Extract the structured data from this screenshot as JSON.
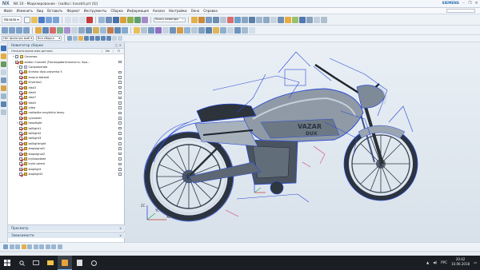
{
  "window": {
    "logo": "NX",
    "title": "NX 10 - Моделирование - [sadko i hovzd4.prt  (S)]",
    "brand": "SIEMENS",
    "controls": [
      "–",
      "❐",
      "✕"
    ]
  },
  "menu": {
    "items": [
      "Файл",
      "Изменить",
      "Вид",
      "Вставить",
      "Формат",
      "Инструменты",
      "Сборки",
      "Информация",
      "Анализ",
      "Настройки",
      "Окно",
      "Справка"
    ]
  },
  "toolbar": {
    "start_label": "Начало ▾",
    "command_search": "Поиск команды",
    "filter_label": "Нет фильтра выб",
    "scope_label": "Вся сборка"
  },
  "navigator": {
    "title": "Навигатор сборки",
    "column_name": "Описательное имя детали",
    "column_info": "Ин",
    "column_p": "П",
    "rows": [
      {
        "indent": 1,
        "expander": "+",
        "checked": false,
        "icon": "folder",
        "label": "Сечения",
        "box": false
      },
      {
        "indent": 1,
        "expander": "–",
        "checked": true,
        "icon": "asm",
        "label": "sadko i hovzd4 (Последовательность: Хра...",
        "box": true
      },
      {
        "indent": 2,
        "expander": "+",
        "checked": false,
        "icon": "con",
        "label": "Сопряжения",
        "box": false
      },
      {
        "indent": 2,
        "expander": "",
        "checked": true,
        "icon": "part",
        "label": "shirsha dlya proverka 5",
        "box": true
      },
      {
        "indent": 2,
        "expander": "",
        "checked": true,
        "icon": "part",
        "label": "korpus batarei",
        "box": true
      },
      {
        "indent": 2,
        "expander": "",
        "checked": true,
        "icon": "part",
        "label": "Kryshka1",
        "box": true
      },
      {
        "indent": 2,
        "expander": "",
        "checked": true,
        "icon": "part",
        "label": "disk3",
        "box": true
      },
      {
        "indent": 2,
        "expander": "",
        "checked": true,
        "icon": "part",
        "label": "disk5",
        "box": true
      },
      {
        "indent": 2,
        "expander": "",
        "checked": true,
        "icon": "part",
        "label": "disk7",
        "box": true
      },
      {
        "indent": 2,
        "expander": "",
        "checked": true,
        "icon": "part",
        "label": "disk5",
        "box": true
      },
      {
        "indent": 2,
        "expander": "",
        "checked": true,
        "icon": "part",
        "label": "vilea",
        "box": true
      },
      {
        "indent": 2,
        "expander": "",
        "checked": true,
        "icon": "part",
        "label": "nakladka maytnika levay",
        "box": true
      },
      {
        "indent": 2,
        "expander": "",
        "checked": true,
        "icon": "part",
        "label": "vyxxadei",
        "box": true
      },
      {
        "indent": 2,
        "expander": "+",
        "checked": true,
        "icon": "part",
        "label": "headlight",
        "box": true
      },
      {
        "indent": 2,
        "expander": "",
        "checked": true,
        "icon": "part",
        "label": "taillight1",
        "box": true
      },
      {
        "indent": 2,
        "expander": "",
        "checked": true,
        "icon": "part",
        "label": "taillight2",
        "box": true
      },
      {
        "indent": 2,
        "expander": "",
        "checked": true,
        "icon": "part",
        "label": "taillight3",
        "box": true
      },
      {
        "indent": 2,
        "expander": "",
        "checked": true,
        "icon": "part",
        "label": "taillightright",
        "box": true
      },
      {
        "indent": 2,
        "expander": "",
        "checked": true,
        "icon": "part",
        "label": "stopsignal1",
        "box": true
      },
      {
        "indent": 2,
        "expander": "",
        "checked": true,
        "icon": "part",
        "label": "stopsignal2",
        "box": true
      },
      {
        "indent": 2,
        "expander": "",
        "checked": true,
        "icon": "part",
        "label": "krylsaadeee",
        "box": true
      },
      {
        "indent": 2,
        "expander": "",
        "checked": true,
        "icon": "part",
        "label": "kryle pered",
        "box": true
      },
      {
        "indent": 2,
        "expander": "",
        "checked": true,
        "icon": "part",
        "label": "stoplight",
        "box": true
      },
      {
        "indent": 2,
        "expander": "",
        "checked": true,
        "icon": "part",
        "label": "stoplight2",
        "box": true
      }
    ],
    "panel_preview": "Просмотр",
    "panel_dependencies": "Зависимости"
  },
  "viewport": {
    "tank_text_line1": "VAZAR",
    "tank_text_line2": "DUX",
    "axis_xc": "XC",
    "axis_yc": "YC",
    "axis_zc": "ZC"
  },
  "taskbar": {
    "time": "20:42",
    "date": "10.06.2018",
    "lang": "РУС"
  },
  "colors": {
    "wire_blue": "#2a4bd8",
    "body_gray": "#8f9aa6",
    "accent_pink": "#d66aa8"
  }
}
